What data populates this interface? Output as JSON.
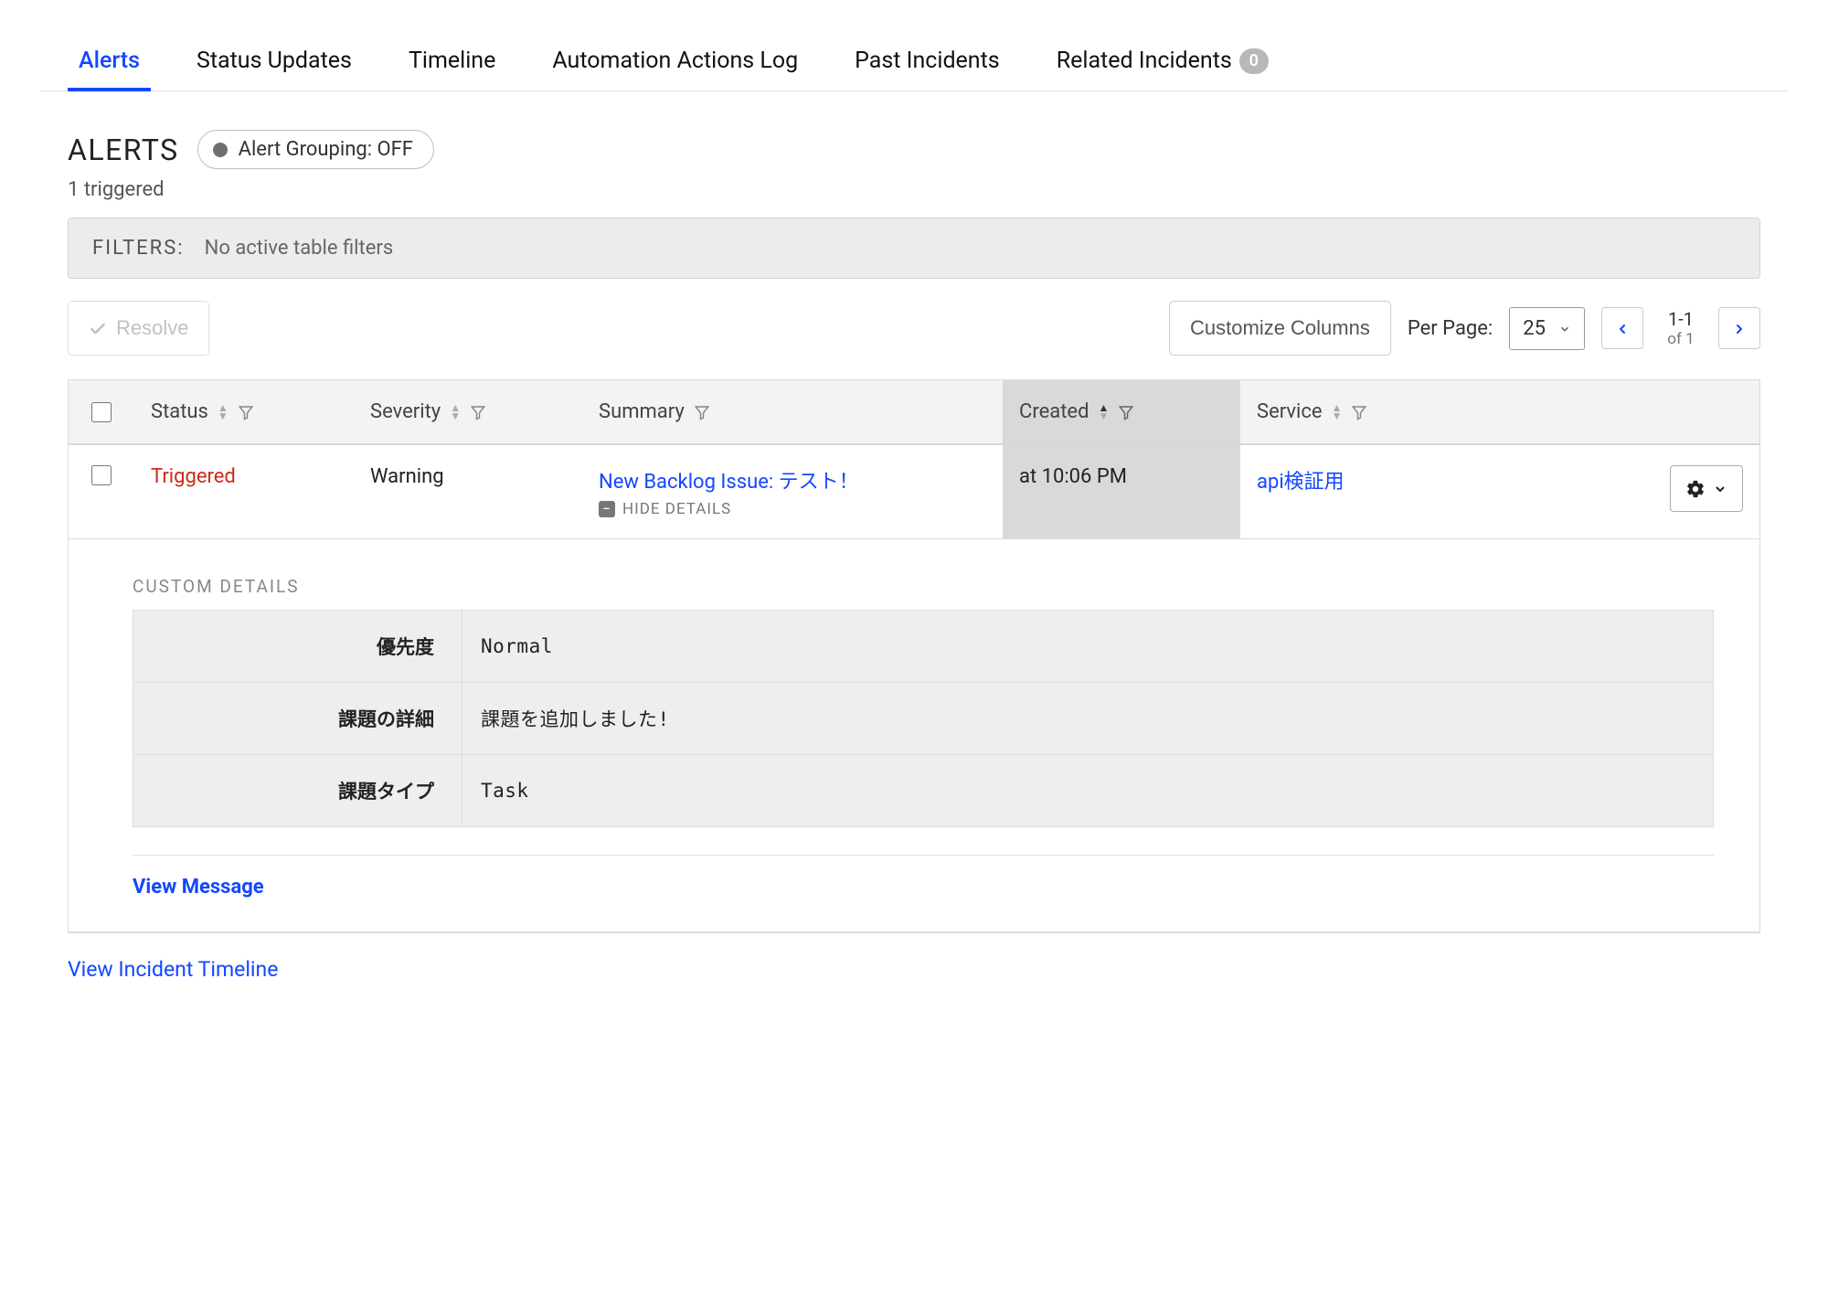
{
  "tabs": [
    {
      "label": "Alerts",
      "active": true
    },
    {
      "label": "Status Updates"
    },
    {
      "label": "Timeline"
    },
    {
      "label": "Automation Actions Log"
    },
    {
      "label": "Past Incidents"
    },
    {
      "label": "Related Incidents",
      "count": "0"
    }
  ],
  "header": {
    "title": "ALERTS",
    "grouping_label": "Alert Grouping: OFF",
    "triggered_text": "1 triggered"
  },
  "filters": {
    "label": "FILTERS:",
    "text": "No active table filters"
  },
  "toolbar": {
    "resolve_label": "Resolve",
    "customize_columns_label": "Customize Columns",
    "per_page_label": "Per Page:",
    "per_page_value": "25",
    "pager_range": "1-1",
    "pager_of": "of 1"
  },
  "columns": {
    "status": "Status",
    "severity": "Severity",
    "summary": "Summary",
    "created": "Created",
    "service": "Service"
  },
  "rows": [
    {
      "status": "Triggered",
      "severity": "Warning",
      "summary": "New Backlog Issue: テスト！",
      "hide_details_label": "HIDE DETAILS",
      "created": "at 10:06 PM",
      "service": "api検証用"
    }
  ],
  "details": {
    "title": "CUSTOM DETAILS",
    "rows": [
      {
        "key": "優先度",
        "value": "Normal"
      },
      {
        "key": "課題の詳細",
        "value": "課題を追加しました!"
      },
      {
        "key": "課題タイプ",
        "value": "Task"
      }
    ],
    "view_message_label": "View Message"
  },
  "footer": {
    "view_timeline_label": "View Incident Timeline"
  }
}
